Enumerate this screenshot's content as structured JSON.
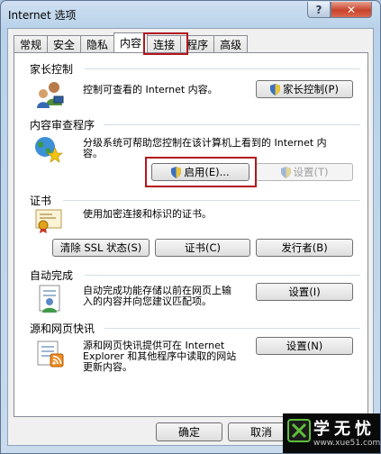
{
  "window": {
    "title": "Internet 选项",
    "help_label": "?",
    "close_label": "✕"
  },
  "tabs": [
    {
      "label": "常规",
      "active": false
    },
    {
      "label": "安全",
      "active": false
    },
    {
      "label": "隐私",
      "active": false
    },
    {
      "label": "内容",
      "active": true
    },
    {
      "label": "连接",
      "active": false
    },
    {
      "label": "程序",
      "active": false
    },
    {
      "label": "高级",
      "active": false
    }
  ],
  "parental": {
    "title": "家长控制",
    "desc": "控制可查看的 Internet 内容。",
    "button": "家长控制(P)"
  },
  "advisor": {
    "title": "内容审查程序",
    "desc_line1": "分级系统可帮助您控制在该计算机上看到的 Internet 内",
    "desc_line2": "容。",
    "enable_button": "启用(E)...",
    "settings_button": "设置(T)"
  },
  "certificates": {
    "title": "证书",
    "desc": "使用加密连接和标识的证书。",
    "clear_ssl_button": "清除 SSL 状态(S)",
    "certificates_button": "证书(C)",
    "publishers_button": "发行者(B)"
  },
  "autocomplete": {
    "title": "自动完成",
    "desc_line1": "自动完成功能存储以前在网页上输",
    "desc_line2": "入的内容并向您建议匹配项。",
    "settings_button": "设置(I)"
  },
  "feeds": {
    "title": "源和网页快讯",
    "desc_line1": "源和网页快讯提供可在 Internet",
    "desc_line2": "Explorer 和其他程序中读取的网站",
    "desc_line3": "更新内容。",
    "settings_button": "设置(N)"
  },
  "footer": {
    "ok": "确定",
    "cancel": "取消"
  },
  "watermark": {
    "text": "学无忧",
    "url": "www.xue51.com"
  },
  "colors": {
    "highlight": "#b3161b",
    "title_bar": "#b9d2ea",
    "panel": "#ffffff"
  }
}
